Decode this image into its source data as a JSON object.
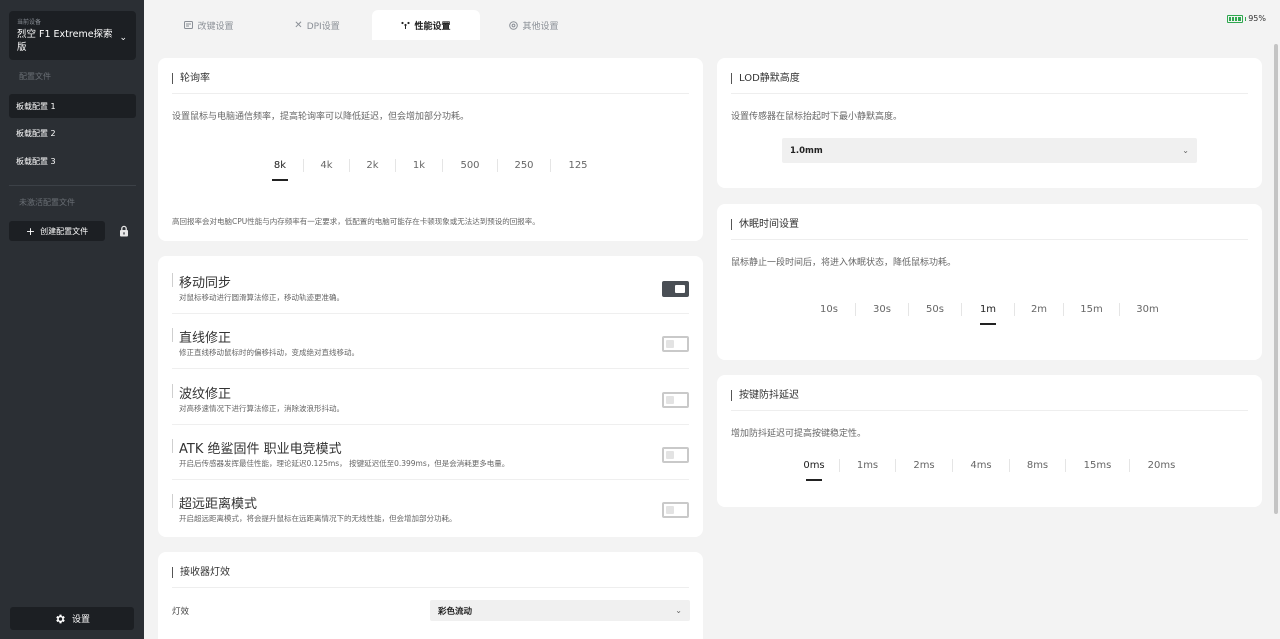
{
  "sidebar": {
    "device_label": "当前设备",
    "device_name": "烈空 F1 Extreme探索版",
    "profiles_label": "配置文件",
    "profiles": [
      {
        "label": "板载配置 1",
        "active": true
      },
      {
        "label": "板载配置 2",
        "active": false
      },
      {
        "label": "板载配置 3",
        "active": false
      }
    ],
    "inactive_label": "未激活配置文件",
    "create_label": "创建配置文件",
    "settings_label": "设置"
  },
  "tabs": [
    {
      "label": "改键设置",
      "icon": "keyboard-icon",
      "active": false
    },
    {
      "label": "DPI设置",
      "icon": "crosshair-icon",
      "active": false
    },
    {
      "label": "性能设置",
      "icon": "performance-icon",
      "active": true
    },
    {
      "label": "其他设置",
      "icon": "settings-circle-icon",
      "active": false
    }
  ],
  "battery": {
    "percent_text": "95%",
    "level": 0.95,
    "color": "#2fa84f"
  },
  "polling": {
    "title": "轮询率",
    "desc": "设置鼠标与电脑通信频率，提高轮询率可以降低延迟，但会增加部分功耗。",
    "options": [
      "8k",
      "4k",
      "2k",
      "1k",
      "500",
      "250",
      "125"
    ],
    "selected": "8k",
    "note": "高回报率会对电脑CPU性能与内存频率有一定要求，低配置的电脑可能存在卡顿现象或无法达到预设的回报率。"
  },
  "toggles": [
    {
      "title": "移动同步",
      "sub": "对鼠标移动进行圆滑算法修正，移动轨迹更准确。",
      "on": true
    },
    {
      "title": "直线修正",
      "sub": "修正直线移动鼠标时的偏移抖动，变成绝对直线移动。",
      "on": false
    },
    {
      "title": "波纹修正",
      "sub": "对高移速情况下进行算法修正，消除波浪形抖动。",
      "on": false
    },
    {
      "title": "ATK 绝鲨固件 职业电竞模式",
      "sub": "开启后传感器发挥最佳性能，理论延迟0.125ms， 按键延迟低至0.399ms，但是会消耗更多电量。",
      "on": false
    },
    {
      "title": "超远距离模式",
      "sub": "开启超远距离模式，将会提升鼠标在远距离情况下的无线性能，但会增加部分功耗。",
      "on": false
    }
  ],
  "receiver": {
    "title": "接收器灯效",
    "effect_label": "灯效",
    "effect_value": "彩色流动"
  },
  "lod": {
    "title": "LOD静默高度",
    "desc": "设置传感器在鼠标抬起时下最小静默高度。",
    "value": "1.0mm"
  },
  "sleep": {
    "title": "休眠时间设置",
    "desc": "鼠标静止一段时间后，将进入休眠状态，降低鼠标功耗。",
    "options": [
      "10s",
      "30s",
      "50s",
      "1m",
      "2m",
      "15m",
      "30m"
    ],
    "selected": "1m"
  },
  "debounce": {
    "title": "按键防抖延迟",
    "desc": "增加防抖延迟可提高按键稳定性。",
    "options": [
      "0ms",
      "1ms",
      "2ms",
      "4ms",
      "8ms",
      "15ms",
      "20ms"
    ],
    "selected": "0ms"
  }
}
